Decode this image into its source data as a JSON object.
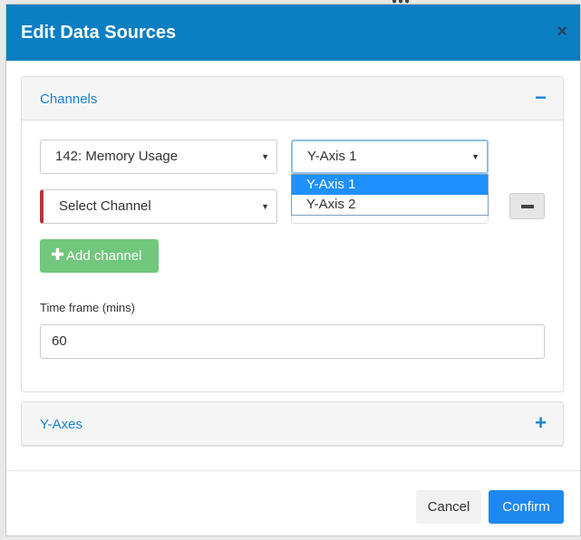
{
  "modal": {
    "title": "Edit Data Sources",
    "close_icon": "×"
  },
  "channels_panel": {
    "title": "Channels",
    "toggle_icon": "−",
    "rows": [
      {
        "channel": "142: Memory Usage",
        "axis": "Y-Axis 1"
      },
      {
        "channel": "Select Channel",
        "axis": ""
      }
    ],
    "axis_options": [
      "Y-Axis 1",
      "Y-Axis 2"
    ],
    "add_button_icon": "✚",
    "add_button_label": "Add channel",
    "remove_icon": "minus-icon",
    "timeframe_label": "Time frame (mins)",
    "timeframe_value": "60"
  },
  "yaxes_panel": {
    "title": "Y-Axes",
    "toggle_icon": "+"
  },
  "footer": {
    "cancel_label": "Cancel",
    "confirm_label": "Confirm"
  },
  "colors": {
    "header": "#0b7fc1",
    "link": "#1a82d6",
    "success": "#71c77c",
    "primary": "#1e88f0",
    "error_border": "#b23b3b"
  }
}
